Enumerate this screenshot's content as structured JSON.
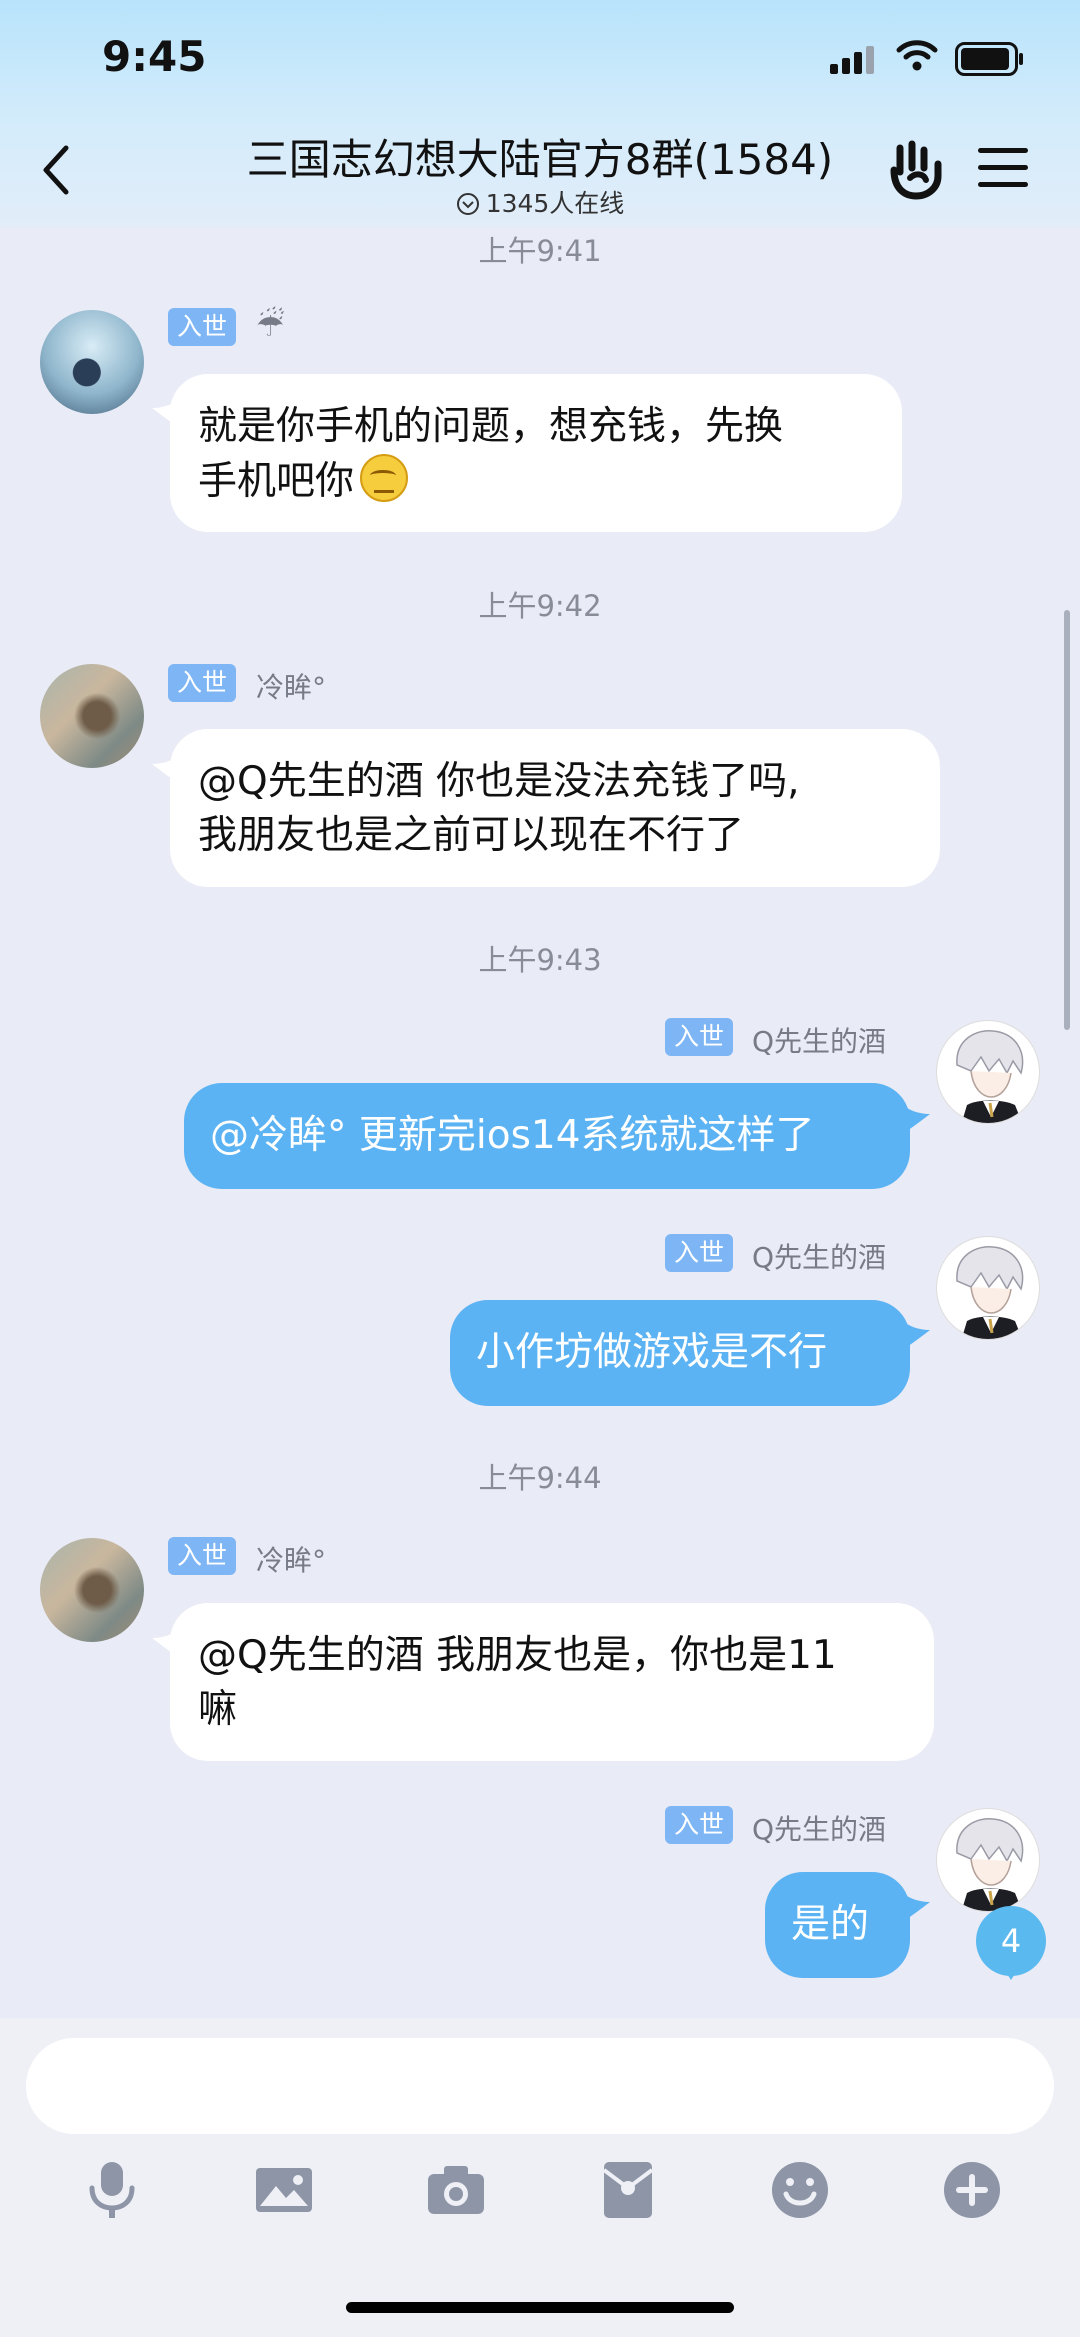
{
  "status": {
    "time": "9:45"
  },
  "header": {
    "title": "三国志幻想大陆官方8群(1584)",
    "online": "1345人在线"
  },
  "messages": [
    {
      "time": "上午9:41"
    },
    {
      "side": "in",
      "badge": "入世",
      "nick": "☔",
      "text1": "就是你手机的问题，想充钱，先换",
      "text2": "手机吧你"
    },
    {
      "time": "上午9:42"
    },
    {
      "side": "in",
      "badge": "入世",
      "nick": "冷眸°",
      "text1": "@Q先生的酒 你也是没法充钱了吗,",
      "text2": "我朋友也是之前可以现在不行了"
    },
    {
      "time": "上午9:43"
    },
    {
      "side": "out",
      "badge": "入世",
      "nick": "Q先生的酒",
      "text1": "@冷眸° 更新完ios14系统就这样了"
    },
    {
      "side": "out",
      "badge": "入世",
      "nick": "Q先生的酒",
      "text1": "小作坊做游戏是不行"
    },
    {
      "time": "上午9:44"
    },
    {
      "side": "in",
      "badge": "入世",
      "nick": "冷眸°",
      "text1": "@Q先生的酒 我朋友也是，你也是11",
      "text2": "嘛"
    },
    {
      "side": "out",
      "badge": "入世",
      "nick": "Q先生的酒",
      "text1": "是的"
    }
  ],
  "unread_count": "4",
  "composer": {
    "placeholder": ""
  },
  "toolbar": [
    "mic-icon",
    "image-icon",
    "camera-icon",
    "red-packet-icon",
    "emoji-icon",
    "plus-icon"
  ],
  "colors": {
    "accent": "#5cb3f3",
    "badge": "#7eb6f5",
    "background": "#e9ebf6"
  }
}
